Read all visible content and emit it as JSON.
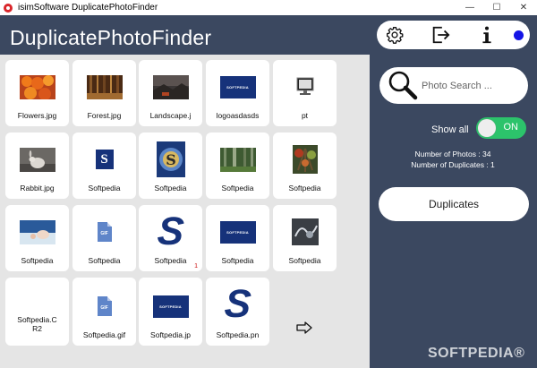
{
  "window": {
    "title": "isimSoftware DuplicatePhotoFinder",
    "minimize": "—",
    "maximize": "☐",
    "close": "✕"
  },
  "app": {
    "brand": "DuplicatePhotoFinder"
  },
  "toolbar": {
    "icons": [
      "gear-icon",
      "exit-icon",
      "info-icon",
      "status-dot-icon"
    ],
    "status_color": "#1414e6"
  },
  "grid": {
    "items": [
      {
        "label": "Flowers.jpg"
      },
      {
        "label": "Forest.jpg"
      },
      {
        "label": "Landscape.j"
      },
      {
        "label": "logoasdasds"
      },
      {
        "label": "pt"
      },
      {
        "label": "Rabbit.jpg"
      },
      {
        "label": "Softpedia"
      },
      {
        "label": "Softpedia"
      },
      {
        "label": "Softpedia"
      },
      {
        "label": "Softpedia"
      },
      {
        "label": "Softpedia"
      },
      {
        "label": "Softpedia"
      },
      {
        "label": "Softpedia",
        "badge": "1"
      },
      {
        "label": "Softpedia"
      },
      {
        "label": "Softpedia"
      },
      {
        "label": "Softpedia.C R2"
      },
      {
        "label": "Softpedia.gif"
      },
      {
        "label": "Softpedia.jp"
      },
      {
        "label": "Softpedia.pn"
      }
    ],
    "logo_text": "SOFTPEDIA",
    "s_letter": "S",
    "gif_text": "GIF",
    "next_icon": "arrow-right-icon"
  },
  "search": {
    "placeholder": "Photo Search ..."
  },
  "filter": {
    "show_all_label": "Show all",
    "toggle_state": "ON"
  },
  "stats": {
    "photos": "Number of Photos : 34",
    "duplicates": "Number of Duplicates : 1"
  },
  "actions": {
    "duplicates_label": "Duplicates"
  },
  "watermark": "SOFTPEDIA®",
  "colors": {
    "background": "#3b4860",
    "grid_bg": "#e5e5e5",
    "toggle_on": "#2cc36b",
    "logo_blue": "#16327a"
  }
}
